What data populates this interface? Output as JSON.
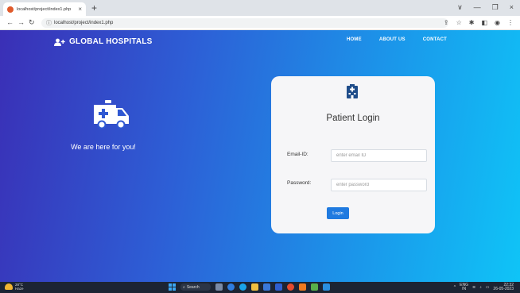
{
  "browser": {
    "tab_title": "localhost/project/index1.php",
    "tab_close": "×",
    "new_tab": "+",
    "url": "localhost/project/index1.php",
    "win_minimize": "∨",
    "win_min": "—",
    "win_max": "❐",
    "win_close": "×"
  },
  "header": {
    "brand": "GLOBAL HOSPITALS",
    "nav": [
      "HOME",
      "ABOUT US",
      "CONTACT"
    ]
  },
  "hero": {
    "tagline": "We are here for you!"
  },
  "login": {
    "title": "Patient Login",
    "email_label": "Email-ID:",
    "email_placeholder": "enter email ID",
    "password_label": "Password:",
    "password_placeholder": "enter password",
    "button": "Login"
  },
  "taskbar": {
    "temperature": "28°C",
    "weather_desc": "Haze",
    "search": "Search",
    "lang": "ENG",
    "region": "IN",
    "time": "22:32",
    "date": "26-05-2023"
  },
  "colors": {
    "gradient_start": "#3a2fb6",
    "gradient_end": "#0fc4f7",
    "button": "#1f7ae0"
  }
}
